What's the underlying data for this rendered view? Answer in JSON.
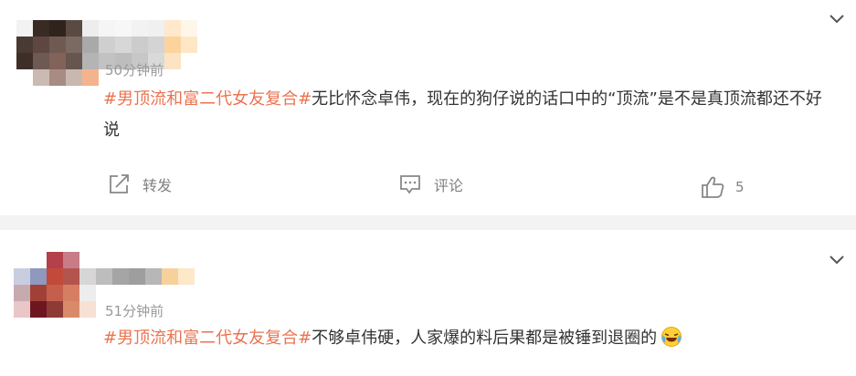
{
  "posts": [
    {
      "time": "50分钟前",
      "topic": "#男顶流和富二代女友复合#",
      "text": "无比怀念卓伟，现在的狗仔说的话口中的“顶流”是不是真顶流都还不好说",
      "actions": {
        "repost": "转发",
        "comment": "评论",
        "like_count": "5"
      }
    },
    {
      "time": "51分钟前",
      "topic": "#男顶流和富二代女友复合#",
      "text": "不够卓伟硬，人家爆的料后果都是被锤到退圈的"
    }
  ],
  "colors": {
    "topic": "#eb7350",
    "text": "#333333",
    "meta": "#999999",
    "separator": "#f3f3f3"
  },
  "icons": [
    "chevron-down-icon",
    "repost-icon",
    "comment-icon",
    "thumbs-up-icon",
    "laughing-tears-emoji"
  ]
}
